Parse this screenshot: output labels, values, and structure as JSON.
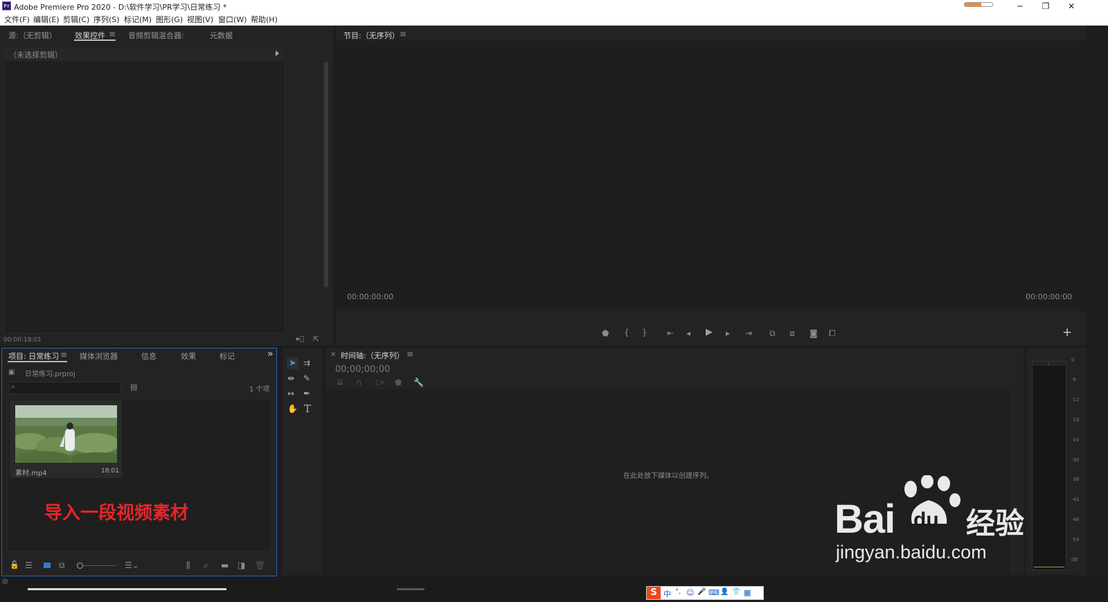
{
  "app": {
    "title": "Adobe Premiere Pro 2020 - D:\\软件学习\\PR学习\\日常练习 *",
    "icon_label": "Pr",
    "title_progress": 0.6,
    "window_controls": {
      "minimize": "─",
      "restore": "❐",
      "close": "✕"
    }
  },
  "menu": [
    "文件(F)",
    "编辑(E)",
    "剪辑(C)",
    "序列(S)",
    "标记(M)",
    "图形(G)",
    "视图(V)",
    "窗口(W)",
    "帮助(H)"
  ],
  "source_panel": {
    "tabs": [
      "源:（无剪辑）",
      "效果控件",
      "音频剪辑混合器:",
      "元数据"
    ],
    "active_tab_index": 1,
    "menu_icon": "≡",
    "no_clip_text": "（未选择剪辑）",
    "timecode": "00:00:18:01"
  },
  "program_panel": {
    "title": "节目:（无序列）",
    "menu_icon": "≡",
    "timecode_left": "00:00:00:00",
    "timecode_right": "00:00:00:00",
    "add_icon": "+"
  },
  "project_panel": {
    "tabs": [
      "项目: 日常练习",
      "媒体浏览器",
      "信息",
      "效果",
      "标记"
    ],
    "active_tab_index": 0,
    "menu_icon": "≡",
    "overflow_icon": "»",
    "project_file": "日常练习.prproj",
    "search_placeholder": "",
    "item_count": "1 个项",
    "clip": {
      "name": "素材.mp4",
      "duration": "18:01"
    },
    "annotation": "导入一段视频素材",
    "colors": {
      "annotation": "#e8242a",
      "selected_border": "#2d63b5"
    }
  },
  "timeline_panel": {
    "close_icon": "×",
    "title": "时间轴:（无序列）",
    "menu_icon": "≡",
    "timecode": "00;00;00;00",
    "drop_hint": "在此处放下媒体以创建序列。"
  },
  "audio_meter": {
    "scale": [
      "0",
      "-6",
      "-12",
      "-18",
      "-24",
      "-30",
      "-36",
      "-42",
      "-48",
      "-54",
      "dB"
    ]
  },
  "watermark": {
    "brand": "Bai",
    "brand2": "du",
    "suffix": "经验",
    "url": "jingyan.baidu.com"
  },
  "ime_bar": {
    "items": [
      "S",
      "中",
      "°,",
      "☺",
      "🎤",
      "⌨",
      "👤",
      "👕",
      "▦"
    ]
  }
}
